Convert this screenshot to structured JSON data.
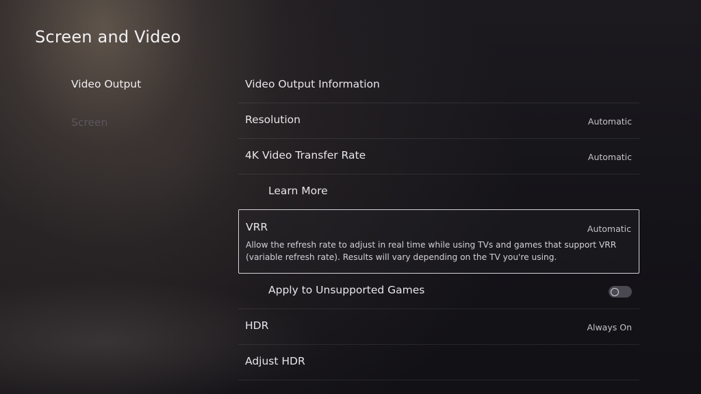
{
  "page": {
    "title": "Screen and Video"
  },
  "left_nav": {
    "items": [
      {
        "label": "Video Output",
        "state": "active"
      },
      {
        "label": "Screen",
        "state": "dimmed"
      }
    ]
  },
  "settings": {
    "rows": [
      {
        "label": "Video Output Information",
        "value": ""
      },
      {
        "label": "Resolution",
        "value": "Automatic"
      },
      {
        "label": "4K Video Transfer Rate",
        "value": "Automatic"
      },
      {
        "label": "Learn More",
        "value": ""
      },
      {
        "label": "VRR",
        "value": "Automatic",
        "description": "Allow the refresh rate to adjust in real time while using TVs and games that support VRR (variable refresh rate). Results will vary depending on the TV you're using."
      },
      {
        "label": "Apply to Unsupported Games",
        "toggle": "off"
      },
      {
        "label": "HDR",
        "value": "Always On"
      },
      {
        "label": "Adjust HDR",
        "value": ""
      }
    ]
  }
}
